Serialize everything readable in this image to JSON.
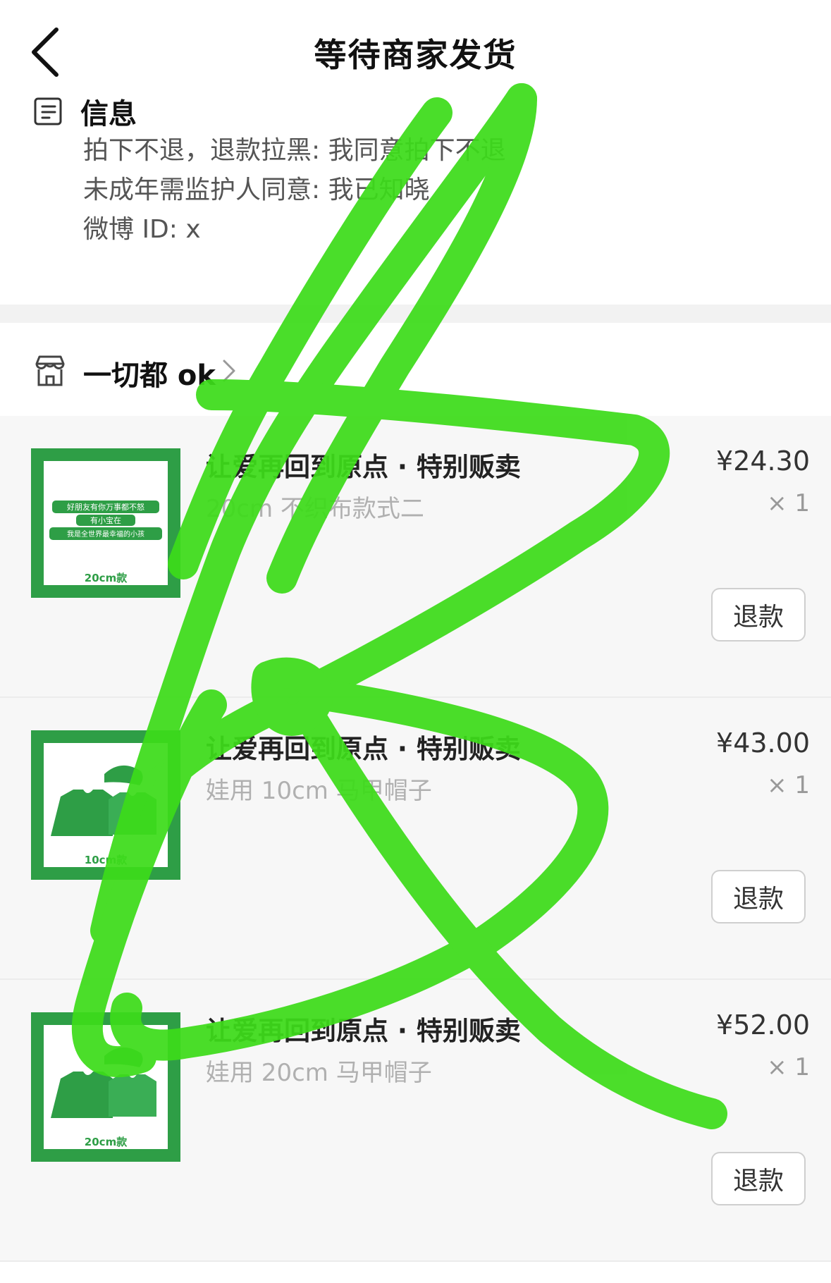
{
  "header": {
    "title": "等待商家发货"
  },
  "info": {
    "title": "信息",
    "lines": [
      "拍下不退，退款拉黑: 我同意拍下不退",
      "未成年需监护人同意: 我已知晓",
      "微博 ID: x"
    ]
  },
  "store": {
    "name": "一切都 ok"
  },
  "products": [
    {
      "name": "让爱再回到原点 · 特别贩卖",
      "spec": "20cm 不织布款式二",
      "price": "¥24.30",
      "qty": "× 1",
      "refund_label": "退款",
      "thumb_tag": "20cm款"
    },
    {
      "name": "让爱再回到原点 · 特别贩卖",
      "spec": "娃用 10cm 马甲帽子",
      "price": "¥43.00",
      "qty": "× 1",
      "refund_label": "退款",
      "thumb_tag": "10cm款"
    },
    {
      "name": "让爱再回到原点 · 特别贩卖",
      "spec": "娃用 20cm 马甲帽子",
      "price": "¥52.00",
      "qty": "× 1",
      "refund_label": "退款",
      "thumb_tag": "20cm款"
    }
  ],
  "thumb1_text": [
    "好朋友有你万事都不怒",
    "有小宝在",
    "我是全世界最幸福的小孩"
  ],
  "colors": {
    "accent_green": "#2e9e46",
    "doodle_green": "#3ddc1a"
  }
}
